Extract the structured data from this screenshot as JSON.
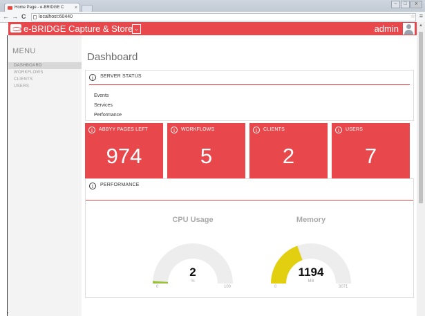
{
  "browser": {
    "tab_title": "Home Page - e-BRIDGE C",
    "tab_close": "×",
    "url": "localhost:60440",
    "back": "←",
    "forward": "→",
    "reload": "C",
    "star": "☆",
    "menu": "≡",
    "win_min": "–",
    "win_max": "□",
    "win_close": "x"
  },
  "header": {
    "brand": "e-BRIDGE Capture & Store",
    "brand_caret": "⌄",
    "user": "admin",
    "color": "#e8484c"
  },
  "sidebar": {
    "title": "MENU",
    "items": [
      {
        "label": "DASHBOARD",
        "active": true
      },
      {
        "label": "WORKFLOWS",
        "active": false
      },
      {
        "label": "CLIENTS",
        "active": false
      },
      {
        "label": "USERS",
        "active": false
      }
    ]
  },
  "main": {
    "title": "Dashboard",
    "server_status": {
      "icon": "i",
      "title": "SERVER STATUS",
      "items": [
        "Events",
        "Services",
        "Performance"
      ]
    },
    "tiles": [
      {
        "icon": "i",
        "label": "ABBYY PAGES LEFT",
        "value": "974"
      },
      {
        "icon": "i",
        "label": "WORKFLOWS",
        "value": "5"
      },
      {
        "icon": "i",
        "label": "CLIENTS",
        "value": "2"
      },
      {
        "icon": "i",
        "label": "USERS",
        "value": "7"
      }
    ],
    "performance": {
      "icon": "i",
      "title": "PERFORMANCE",
      "gauges": [
        {
          "title": "CPU Usage",
          "value": "2",
          "unit": "%",
          "min": "0",
          "max": "100",
          "fraction": 0.02,
          "color": "#9bc13b"
        },
        {
          "title": "Memory",
          "value": "1194",
          "unit": "MB",
          "min": "0",
          "max": "3071",
          "fraction": 0.389,
          "color": "#e2cf10"
        }
      ]
    }
  }
}
